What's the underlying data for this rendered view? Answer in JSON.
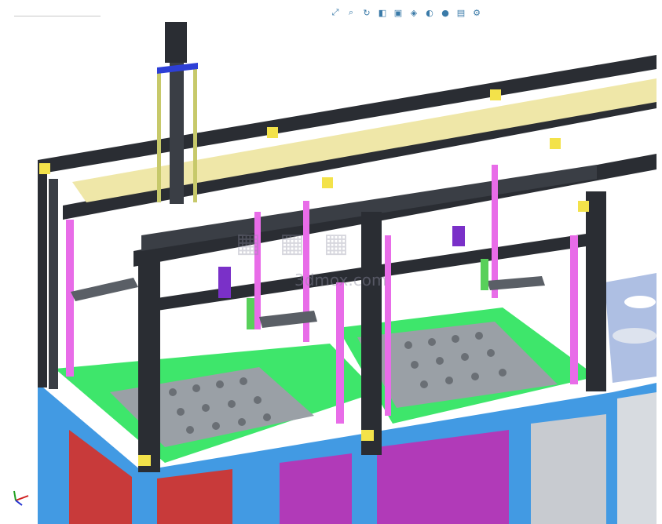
{
  "watermark": {
    "text": "3dmox",
    "domain": ".com"
  },
  "toolbar": {
    "icons": [
      "zoom-fit-icon",
      "zoom-area-icon",
      "rotate-icon",
      "section-view-icon",
      "view-orientation-icon",
      "display-style-icon",
      "hide-show-icon",
      "appearance-icon",
      "scene-icon",
      "view-settings-icon"
    ]
  },
  "colors": {
    "frame": "#2a2d33",
    "base_green": "#3ee66b",
    "base_blue": "#2e8fe0",
    "pink_rod": "#e86ce8",
    "yellow_bracket": "#f3e24a",
    "panel_red": "#c83a3a",
    "panel_magenta": "#b13ab8",
    "plate_gray": "#9aa0a6"
  }
}
